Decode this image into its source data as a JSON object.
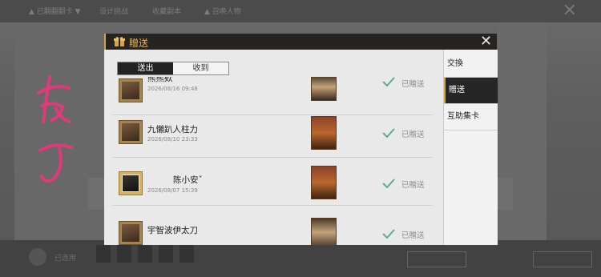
{
  "background": {
    "top_items": [
      "▲ 已翻翻翻卡 ▼",
      "设计挑战",
      "收藏副本",
      "▲ 召唤人物"
    ],
    "bottom_name": "已连用"
  },
  "dialog": {
    "title": "贈送",
    "close_icon": "close-icon",
    "segment": {
      "sent_label": "送出",
      "received_label": "收到"
    },
    "rows": [
      {
        "name": "熊熊欸",
        "date": "2026/08/16 09:48",
        "status": "已贈送",
        "card_style": "dark"
      },
      {
        "name": "九懶趴人柱力",
        "date": "2026/08/10 23:33",
        "status": "已贈送",
        "card_style": "fire"
      },
      {
        "name": "陈小安ˇ",
        "date": "2026/08/07 15:39",
        "status": "已贈送",
        "card_style": "fire"
      },
      {
        "name": "宇智波伊太刀",
        "date": "",
        "status": "已贈送",
        "card_style": "dark"
      }
    ],
    "sidebar": [
      "交換",
      "贈送",
      "互助集卡"
    ]
  },
  "colors": {
    "accent_gold": "#d7a441",
    "check_green": "#5cae86",
    "header_dark": "#262321"
  }
}
